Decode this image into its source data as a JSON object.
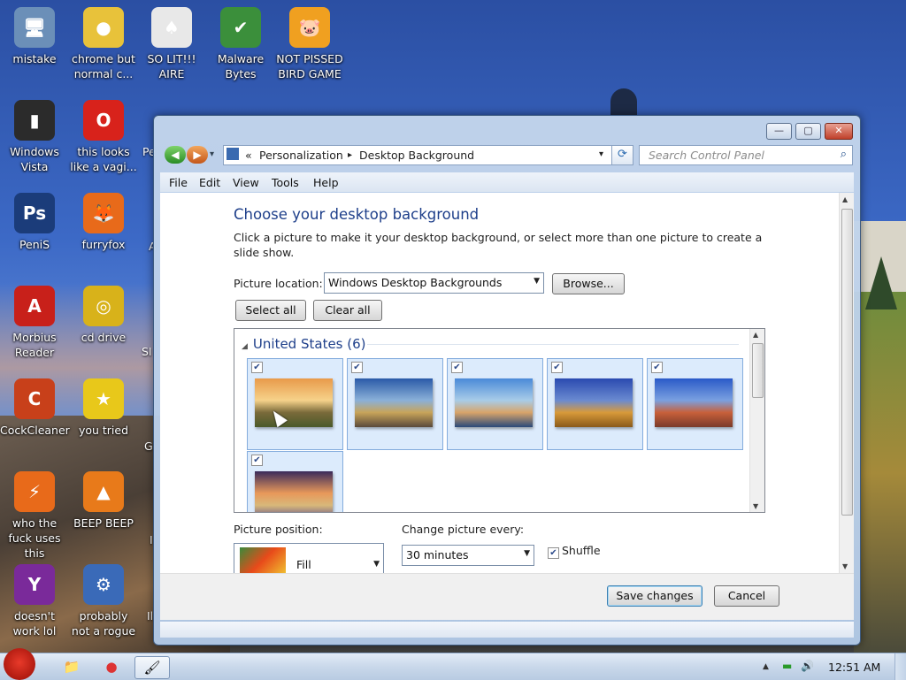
{
  "desktop": {
    "icons": [
      {
        "label": "mistake",
        "glyph": "🖥",
        "bg": "#6b8fb8"
      },
      {
        "label": "chrome but normal c...",
        "glyph": "●",
        "bg": "#e8c23a"
      },
      {
        "label": "SO LIT!!! AIRE",
        "glyph": "♠",
        "bg": "#e8e8e8"
      },
      {
        "label": "Malware Bytes",
        "glyph": "✔",
        "bg": "#3b8f3b"
      },
      {
        "label": "NOT PISSED BIRD GAME",
        "glyph": "🐷",
        "bg": "#f0a020"
      },
      {
        "label": "Windows Vista",
        "glyph": "▮",
        "bg": "#2b2b2b"
      },
      {
        "label": "this looks like a vagi...",
        "glyph": "O",
        "bg": "#d8221b"
      },
      {
        "label": "PeniS",
        "glyph": "Ps",
        "bg": "#1b3c7a"
      },
      {
        "label": "furryfox",
        "glyph": "🦊",
        "bg": "#e86a1a"
      },
      {
        "label": "Morbius Reader",
        "glyph": "A",
        "bg": "#c8201a"
      },
      {
        "label": "cd drive",
        "glyph": "◎",
        "bg": "#d8b21a"
      },
      {
        "label": "CockCleaner",
        "glyph": "C",
        "bg": "#c8401a"
      },
      {
        "label": "you tried",
        "glyph": "★",
        "bg": "#e8c81a"
      },
      {
        "label": "who the fuck uses this",
        "glyph": "⚡",
        "bg": "#e86a1a"
      },
      {
        "label": "BEEP BEEP",
        "glyph": "▲",
        "bg": "#e87a1a"
      },
      {
        "label": "doesn't work lol",
        "glyph": "Y",
        "bg": "#7a2a9a"
      },
      {
        "label": "probably not a rogue",
        "glyph": "⚙",
        "bg": "#3a6ab8"
      }
    ],
    "partial_labels": [
      "Pe",
      "SI",
      "G",
      "A",
      "Il",
      "I"
    ]
  },
  "window": {
    "title_buttons": {
      "minimize": "—",
      "maximize": "▢",
      "close": "✕"
    },
    "nav": {
      "back": "◀",
      "forward": "▶",
      "history": "▾"
    },
    "breadcrumb": {
      "chevrons": "«",
      "parent": "Personalization",
      "separator": "▸",
      "current": "Desktop Background",
      "dropdown": "▾"
    },
    "refresh": "⟳",
    "search": {
      "placeholder": "Search Control Panel",
      "icon": "⌕"
    },
    "menu": [
      "File",
      "Edit",
      "View",
      "Tools",
      "Help"
    ]
  },
  "page": {
    "title": "Choose your desktop background",
    "description": "Click a picture to make it your desktop background, or select more than one picture to create a slide show.",
    "picture_location_label": "Picture location:",
    "picture_location_value": "Windows Desktop Backgrounds",
    "browse_button": "Browse...",
    "select_all_button": "Select all",
    "clear_all_button": "Clear all",
    "gallery": {
      "group_label": "United States (6)",
      "tiles": [
        {
          "checked": true,
          "colors": [
            "#e89a4a",
            "#f6d28a",
            "#7a6a3a",
            "#4a5a2a"
          ]
        },
        {
          "checked": true,
          "colors": [
            "#2a5aa8",
            "#8ab0d8",
            "#c8a45a",
            "#5a4a3a"
          ]
        },
        {
          "checked": true,
          "colors": [
            "#4a8ad8",
            "#a8cce8",
            "#d8a46a",
            "#2a4a7a"
          ]
        },
        {
          "checked": true,
          "colors": [
            "#2a4ab0",
            "#6a8ad0",
            "#d89a3a",
            "#8a5a1a"
          ]
        },
        {
          "checked": true,
          "colors": [
            "#2a5ac8",
            "#7aa0e0",
            "#c8603a",
            "#7a3a2a"
          ]
        },
        {
          "checked": true,
          "colors": [
            "#3a2a5a",
            "#e8985a",
            "#d8b87a",
            "#5a4a8a"
          ]
        }
      ]
    },
    "picture_position_label": "Picture position:",
    "picture_position_value": "Fill",
    "change_every_label": "Change picture every:",
    "change_every_value": "30 minutes",
    "shuffle_label": "Shuffle",
    "shuffle_checked": true,
    "save_button": "Save changes",
    "cancel_button": "Cancel"
  },
  "taskbar": {
    "clock": "12:51 AM",
    "items": [
      "📁",
      "●",
      "🖌"
    ],
    "tray": [
      "▲",
      "▬",
      "🔊"
    ]
  }
}
